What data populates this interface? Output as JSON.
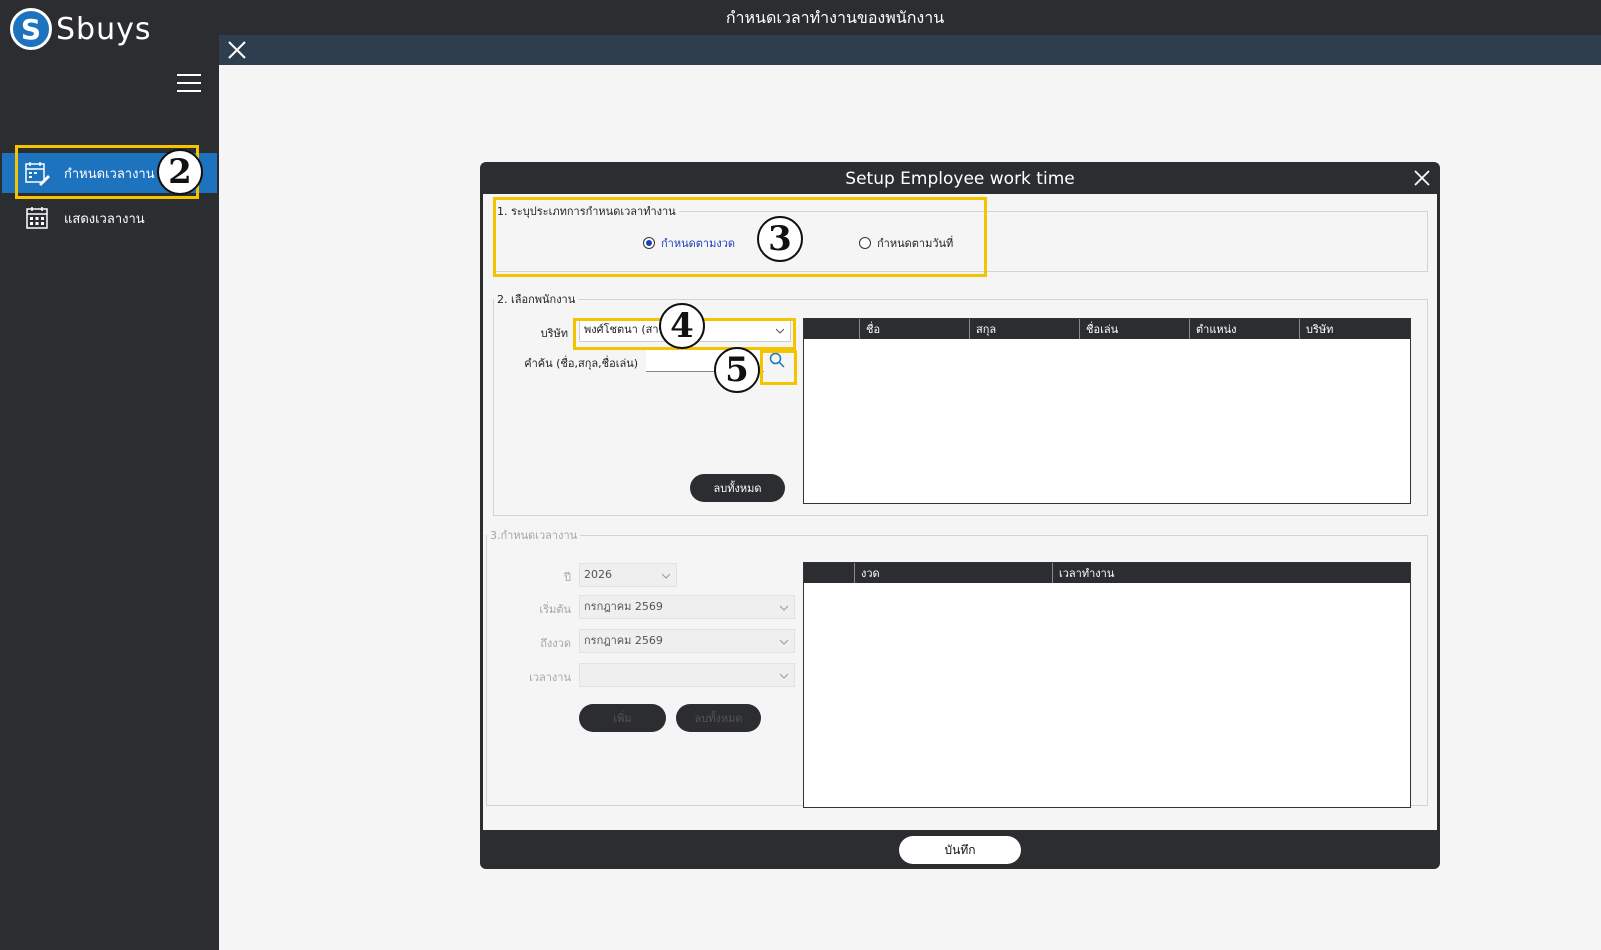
{
  "sidebar": {
    "logo_letter": "S",
    "logo_text": "Sbuys",
    "items": [
      {
        "label": "กำหนดเวลางาน",
        "icon": "calendar-edit-icon",
        "active": true
      },
      {
        "label": "แสดงเวลางาน",
        "icon": "calendar-grid-icon",
        "active": false
      }
    ]
  },
  "header": {
    "title": "กำหนดเวลาทำงานของพนักงาน"
  },
  "dialog": {
    "title": "Setup Employee work time",
    "section1": {
      "legend": "1. ระบุประเภทการกำหนดเวลาทำงาน",
      "options": [
        {
          "label": "กำหนดตามงวด",
          "checked": true
        },
        {
          "label": "กำหนดตามวันที่",
          "checked": false
        }
      ]
    },
    "section2": {
      "legend": "2. เลือกพนักงาน",
      "company_label": "บริษัท",
      "company_value": "พงศ์โชตนา (สาข",
      "search_label": "คำค้น (ชื่อ,สกุล,ชื่อเล่น)",
      "search_value": "",
      "clear_button": "ลบทั้งหมด",
      "columns": [
        "",
        "ชื่อ",
        "สกุล",
        "ชื่อเล่น",
        "ตำแหน่ง",
        "บริษัท"
      ]
    },
    "section3": {
      "legend": "3.กำหนดเวลางาน",
      "year_label": "ปี",
      "year_value": "2026",
      "start_label": "เริ่มต้น",
      "start_value": "กรกฎาคม 2569",
      "end_label": "ถึงงวด",
      "end_value": "กรกฎาคม 2569",
      "worktime_label": "เวลางาน",
      "worktime_value": "",
      "add_button": "เพิ่ม",
      "clear_button": "ลบทั้งหมด",
      "columns": [
        "",
        "งวด",
        "เวลาทำงาน"
      ]
    },
    "save_button": "บันทึก"
  },
  "annotations": [
    "2",
    "3",
    "4",
    "5"
  ],
  "colors": {
    "sidebar_bg": "#2b2d31",
    "active_item": "#1e73be",
    "highlight": "#f5c400",
    "subbar": "#2f3e4e"
  }
}
